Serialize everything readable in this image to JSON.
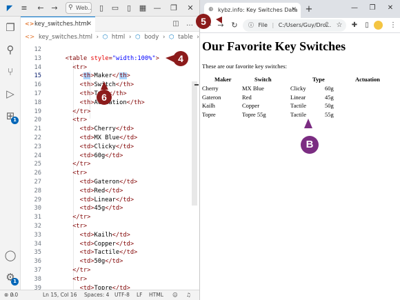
{
  "vscode": {
    "title_search": "Web...",
    "tab": {
      "icon": "<>",
      "label": "key_switches.html"
    },
    "breadcrumb": [
      "key_switches.html",
      "html",
      "body",
      "table",
      "tr"
    ],
    "code": [
      {
        "n": "12",
        "segs": []
      },
      {
        "n": "13",
        "segs": [
          [
            "tag",
            "<table "
          ],
          [
            "at",
            "style"
          ],
          [
            "tag",
            "="
          ],
          [
            "av",
            "\"width:100%\""
          ],
          [
            "tag",
            ">"
          ]
        ]
      },
      {
        "n": "14",
        "segs": [
          [
            "tag",
            "<tr>"
          ]
        ]
      },
      {
        "n": "15",
        "segs": [
          [
            "tag",
            "<"
          ],
          [
            "hl",
            "th"
          ],
          [
            "tag",
            ">"
          ],
          [
            "tx",
            "Maker"
          ],
          [
            "tag",
            "</"
          ],
          [
            "hl",
            "th"
          ],
          [
            "tag",
            ">"
          ]
        ]
      },
      {
        "n": "16",
        "segs": [
          [
            "tag",
            "<th>"
          ],
          [
            "tx",
            "Switch"
          ],
          [
            "tag",
            "</th>"
          ]
        ]
      },
      {
        "n": "17",
        "segs": [
          [
            "tag",
            "<th>"
          ],
          [
            "tx",
            "Type"
          ],
          [
            "tag",
            "</th>"
          ]
        ]
      },
      {
        "n": "18",
        "segs": [
          [
            "tag",
            "<th>"
          ],
          [
            "tx",
            "Actuation"
          ],
          [
            "tag",
            "</th>"
          ]
        ]
      },
      {
        "n": "19",
        "segs": [
          [
            "tag",
            "</tr>"
          ]
        ]
      },
      {
        "n": "20",
        "segs": [
          [
            "tag",
            "<tr>"
          ]
        ]
      },
      {
        "n": "21",
        "segs": [
          [
            "tag",
            "<td>"
          ],
          [
            "tx",
            "Cherry"
          ],
          [
            "tag",
            "</td>"
          ]
        ]
      },
      {
        "n": "22",
        "segs": [
          [
            "tag",
            "<td>"
          ],
          [
            "tx",
            "MX Blue"
          ],
          [
            "tag",
            "</td>"
          ]
        ]
      },
      {
        "n": "23",
        "segs": [
          [
            "tag",
            "<td>"
          ],
          [
            "tx",
            "Clicky"
          ],
          [
            "tag",
            "</td>"
          ]
        ]
      },
      {
        "n": "24",
        "segs": [
          [
            "tag",
            "<td>"
          ],
          [
            "tx",
            "60g"
          ],
          [
            "tag",
            "</td>"
          ]
        ]
      },
      {
        "n": "25",
        "segs": [
          [
            "tag",
            "</tr>"
          ]
        ]
      },
      {
        "n": "26",
        "segs": [
          [
            "tag",
            "<tr>"
          ]
        ]
      },
      {
        "n": "27",
        "segs": [
          [
            "tag",
            "<td>"
          ],
          [
            "tx",
            "Gateron"
          ],
          [
            "tag",
            "</td>"
          ]
        ]
      },
      {
        "n": "28",
        "segs": [
          [
            "tag",
            "<td>"
          ],
          [
            "tx",
            "Red"
          ],
          [
            "tag",
            "</td>"
          ]
        ]
      },
      {
        "n": "29",
        "segs": [
          [
            "tag",
            "<td>"
          ],
          [
            "tx",
            "Linear"
          ],
          [
            "tag",
            "</td>"
          ]
        ]
      },
      {
        "n": "30",
        "segs": [
          [
            "tag",
            "<td>"
          ],
          [
            "tx",
            "45g"
          ],
          [
            "tag",
            "</td>"
          ]
        ]
      },
      {
        "n": "31",
        "segs": [
          [
            "tag",
            "</tr>"
          ]
        ]
      },
      {
        "n": "32",
        "segs": [
          [
            "tag",
            "<tr>"
          ]
        ]
      },
      {
        "n": "33",
        "segs": [
          [
            "tag",
            "<td>"
          ],
          [
            "tx",
            "Kailh"
          ],
          [
            "tag",
            "</td>"
          ]
        ]
      },
      {
        "n": "34",
        "segs": [
          [
            "tag",
            "<td>"
          ],
          [
            "tx",
            "Copper"
          ],
          [
            "tag",
            "</td>"
          ]
        ]
      },
      {
        "n": "35",
        "segs": [
          [
            "tag",
            "<td>"
          ],
          [
            "tx",
            "Tactile"
          ],
          [
            "tag",
            "</td>"
          ]
        ]
      },
      {
        "n": "36",
        "segs": [
          [
            "tag",
            "<td>"
          ],
          [
            "tx",
            "50g"
          ],
          [
            "tag",
            "</td>"
          ]
        ]
      },
      {
        "n": "37",
        "segs": [
          [
            "tag",
            "</tr>"
          ]
        ]
      },
      {
        "n": "38",
        "segs": [
          [
            "tag",
            "<tr>"
          ]
        ]
      },
      {
        "n": "39",
        "segs": [
          [
            "tag",
            "<td>"
          ],
          [
            "tx",
            "Topre"
          ],
          [
            "tag",
            "</td>"
          ]
        ]
      }
    ],
    "status": {
      "errors": "0",
      "warnings": "0",
      "position": "Ln 15, Col 16",
      "spaces": "Spaces: 4",
      "encoding": "UTF-8",
      "eol": "LF",
      "language": "HTML"
    },
    "extensions_badge": "1",
    "settings_badge": "1"
  },
  "browser": {
    "tab_title": "kybz.info: Key Switches Data",
    "address_label": "File",
    "address": "C:/Users/Guy/Dro...",
    "page": {
      "heading": "Our Favorite Key Switches",
      "intro": "These are our favorite key switches:",
      "headers": [
        "Maker",
        "Switch",
        "Type",
        "Actuation"
      ],
      "rows": [
        [
          "Cherry",
          "MX Blue",
          "Clicky",
          "60g"
        ],
        [
          "Gateron",
          "Red",
          "Linear",
          "45g"
        ],
        [
          "Kailh",
          "Copper",
          "Tactile",
          "50g"
        ],
        [
          "Topre",
          "Topre 55g",
          "Tactile",
          "55g"
        ]
      ]
    }
  },
  "callouts": {
    "c4": "4",
    "c5": "5",
    "c6": "6",
    "cB": "B"
  },
  "colors": {
    "callout_red": "#8c1b1b",
    "callout_purple": "#7b2d82",
    "accent": "#0078d4"
  }
}
